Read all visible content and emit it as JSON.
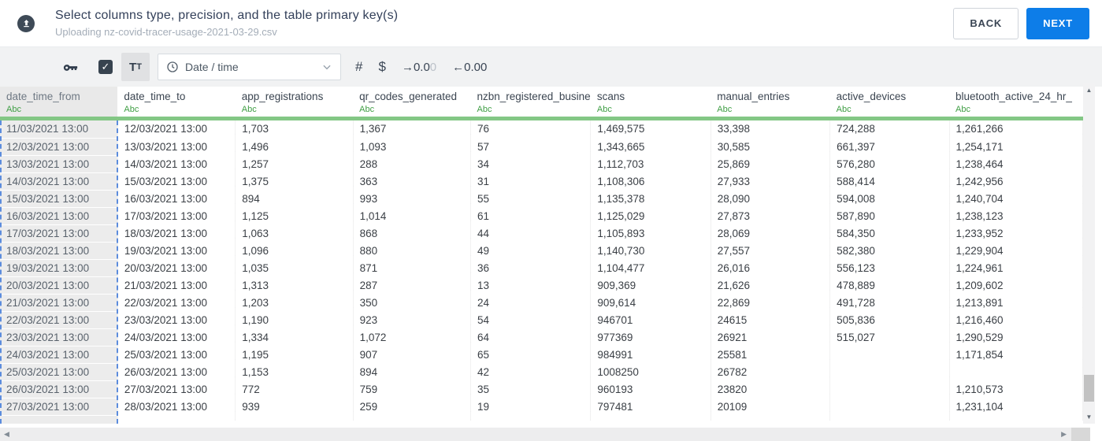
{
  "header": {
    "title": "Select columns type, precision, and the table primary key(s)",
    "subtitle": "Uploading nz-covid-tracer-usage-2021-03-29.csv",
    "back_label": "BACK",
    "next_label": "NEXT"
  },
  "toolbar": {
    "checkbox_checked": true,
    "check_glyph": "✓",
    "text_type_label_big": "T",
    "text_type_label_small": "T",
    "type_dropdown_value": "Date / time",
    "number_symbol": "#",
    "currency_symbol": "$",
    "decimal_right_prefix": "→0.0",
    "decimal_right_suffix": "0",
    "decimal_left": "←0.00"
  },
  "table": {
    "type_label": "Abc",
    "selected_column": "date_time_from",
    "columns": [
      "date_time_from",
      "date_time_to",
      "app_registrations",
      "qr_codes_generated",
      "nzbn_registered_busine",
      "scans",
      "manual_entries",
      "active_devices",
      "bluetooth_active_24_hr_"
    ],
    "rows": [
      [
        "11/03/2021 13:00",
        "12/03/2021 13:00",
        "1,703",
        "1,367",
        "76",
        "1,469,575",
        "33,398",
        "724,288",
        "1,261,266"
      ],
      [
        "12/03/2021 13:00",
        "13/03/2021 13:00",
        "1,496",
        "1,093",
        "57",
        "1,343,665",
        "30,585",
        "661,397",
        "1,254,171"
      ],
      [
        "13/03/2021 13:00",
        "14/03/2021 13:00",
        "1,257",
        "288",
        "34",
        "1,112,703",
        "25,869",
        "576,280",
        "1,238,464"
      ],
      [
        "14/03/2021 13:00",
        "15/03/2021 13:00",
        "1,375",
        "363",
        "31",
        "1,108,306",
        "27,933",
        "588,414",
        "1,242,956"
      ],
      [
        "15/03/2021 13:00",
        "16/03/2021 13:00",
        "894",
        "993",
        "55",
        "1,135,378",
        "28,090",
        "594,008",
        "1,240,704"
      ],
      [
        "16/03/2021 13:00",
        "17/03/2021 13:00",
        "1,125",
        "1,014",
        "61",
        "1,125,029",
        "27,873",
        "587,890",
        "1,238,123"
      ],
      [
        "17/03/2021 13:00",
        "18/03/2021 13:00",
        "1,063",
        "868",
        "44",
        "1,105,893",
        "28,069",
        "584,350",
        "1,233,952"
      ],
      [
        "18/03/2021 13:00",
        "19/03/2021 13:00",
        "1,096",
        "880",
        "49",
        "1,140,730",
        "27,557",
        "582,380",
        "1,229,904"
      ],
      [
        "19/03/2021 13:00",
        "20/03/2021 13:00",
        "1,035",
        "871",
        "36",
        "1,104,477",
        "26,016",
        "556,123",
        "1,224,961"
      ],
      [
        "20/03/2021 13:00",
        "21/03/2021 13:00",
        "1,313",
        "287",
        "13",
        "909,369",
        "21,626",
        "478,889",
        "1,209,602"
      ],
      [
        "21/03/2021 13:00",
        "22/03/2021 13:00",
        "1,203",
        "350",
        "24",
        "909,614",
        "22,869",
        "491,728",
        "1,213,891"
      ],
      [
        "22/03/2021 13:00",
        "23/03/2021 13:00",
        "1,190",
        "923",
        "54",
        "946701",
        "24615",
        "505,836",
        "1,216,460"
      ],
      [
        "23/03/2021 13:00",
        "24/03/2021 13:00",
        "1,334",
        "1,072",
        "64",
        "977369",
        "26921",
        "515,027",
        "1,290,529"
      ],
      [
        "24/03/2021 13:00",
        "25/03/2021 13:00",
        "1,195",
        "907",
        "65",
        "984991",
        "25581",
        "",
        "1,171,854"
      ],
      [
        "25/03/2021 13:00",
        "26/03/2021 13:00",
        "1,153",
        "894",
        "42",
        "1008250",
        "26782",
        "",
        ""
      ],
      [
        "26/03/2021 13:00",
        "27/03/2021 13:00",
        "772",
        "759",
        "35",
        "960193",
        "23820",
        "",
        "1,210,573"
      ],
      [
        "27/03/2021 13:00",
        "28/03/2021 13:00",
        "939",
        "259",
        "19",
        "797481",
        "20109",
        "",
        "1,231,104"
      ]
    ]
  },
  "scrollbars": {
    "up_arrow": "▲",
    "down_arrow": "▼",
    "left_arrow": "◀",
    "right_arrow": "▶"
  },
  "colors": {
    "accent_blue": "#0d7de8",
    "type_green": "#3f9e44",
    "green_bar": "#83c785",
    "selection_dash_blue": "#5c8cdd",
    "selected_column_bg": "#ececec",
    "dark_navy": "#33405a"
  }
}
